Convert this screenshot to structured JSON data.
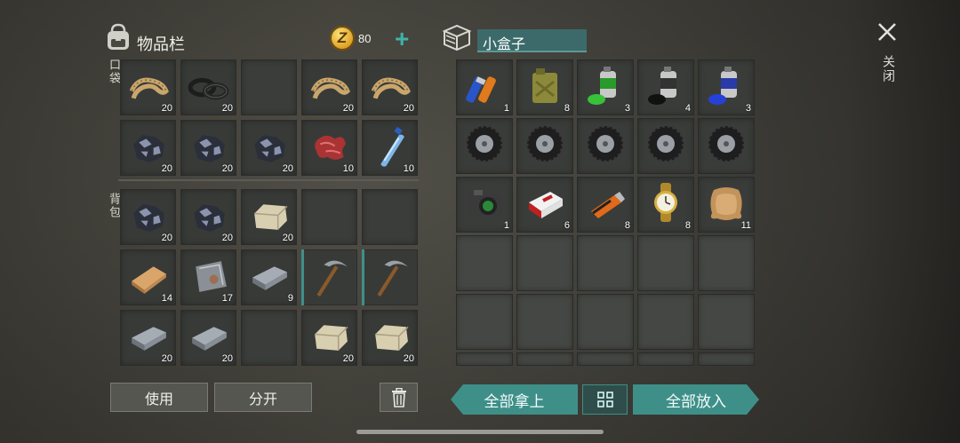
{
  "inventory": {
    "title": "物品栏",
    "coins": "80",
    "coin_symbol": "Z",
    "add_label": "+",
    "pocket_label": "口袋",
    "backpack_label": "背包",
    "pocket_rows": [
      [
        {
          "item": "rope",
          "count": "20"
        },
        {
          "item": "rubber-rings",
          "count": "20"
        },
        {
          "item": "",
          "count": ""
        },
        {
          "item": "rope",
          "count": "20"
        },
        {
          "item": "rope",
          "count": "20"
        }
      ],
      [
        {
          "item": "coal-ore",
          "count": "20"
        },
        {
          "item": "coal-ore",
          "count": "20"
        },
        {
          "item": "coal-ore",
          "count": "20"
        },
        {
          "item": "raw-meat",
          "count": "10"
        },
        {
          "item": "water-bottle",
          "count": "10"
        }
      ]
    ],
    "backpack_rows": [
      [
        {
          "item": "coal-ore",
          "count": "20"
        },
        {
          "item": "coal-ore",
          "count": "20"
        },
        {
          "item": "limestone",
          "count": "20"
        },
        {
          "item": "",
          "count": ""
        },
        {
          "item": "",
          "count": ""
        }
      ],
      [
        {
          "item": "wood-plank",
          "count": "14"
        },
        {
          "item": "steel-plate",
          "count": "17"
        },
        {
          "item": "iron-bar",
          "count": "9"
        },
        {
          "item": "pickaxe",
          "count": ""
        },
        {
          "item": "pickaxe",
          "count": ""
        }
      ],
      [
        {
          "item": "iron-bar",
          "count": "20"
        },
        {
          "item": "iron-bar",
          "count": "20"
        },
        {
          "item": "",
          "count": ""
        },
        {
          "item": "limestone",
          "count": "20"
        },
        {
          "item": "limestone",
          "count": "20"
        }
      ]
    ]
  },
  "container": {
    "name": "小盒子",
    "rows": [
      [
        {
          "item": "batteries",
          "count": "1"
        },
        {
          "item": "jerry-can",
          "count": "8"
        },
        {
          "item": "spray-green",
          "count": "3"
        },
        {
          "item": "spray-black",
          "count": "4"
        },
        {
          "item": "spray-blue",
          "count": "3"
        }
      ],
      [
        {
          "item": "tire",
          "count": ""
        },
        {
          "item": "tire",
          "count": ""
        },
        {
          "item": "tire",
          "count": ""
        },
        {
          "item": "tire",
          "count": ""
        },
        {
          "item": "tire",
          "count": ""
        }
      ],
      [
        {
          "item": "camera",
          "count": "1"
        },
        {
          "item": "cigarettes",
          "count": "6"
        },
        {
          "item": "usb-drive",
          "count": "8"
        },
        {
          "item": "watch",
          "count": "8"
        },
        {
          "item": "leather",
          "count": "11"
        }
      ]
    ]
  },
  "close_label": "关闭",
  "buttons": {
    "use": "使用",
    "split": "分开",
    "take_all": "全部拿上",
    "put_all": "全部放入"
  }
}
